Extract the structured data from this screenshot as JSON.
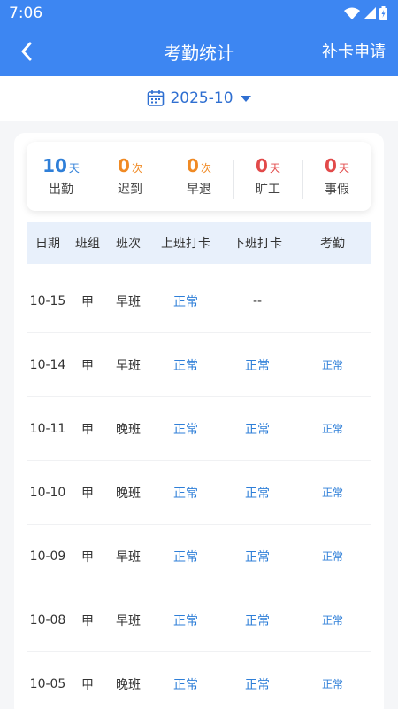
{
  "status_bar": {
    "time": "7:06"
  },
  "nav": {
    "title": "考勤统计",
    "action": "补卡申请"
  },
  "month_selector": {
    "value": "2025-10"
  },
  "colors": {
    "header": "#3d86f2",
    "blue": "#2f7fd8",
    "orange": "#f08a24",
    "red": "#e24a4a"
  },
  "summary": [
    {
      "value": "10",
      "unit": "天",
      "label": "出勤",
      "color": "#2f7fd8"
    },
    {
      "value": "0",
      "unit": "次",
      "label": "迟到",
      "color": "#f08a24"
    },
    {
      "value": "0",
      "unit": "次",
      "label": "早退",
      "color": "#f08a24"
    },
    {
      "value": "0",
      "unit": "天",
      "label": "旷工",
      "color": "#e24a4a"
    },
    {
      "value": "0",
      "unit": "天",
      "label": "事假",
      "color": "#e24a4a"
    }
  ],
  "table": {
    "headers": [
      "日期",
      "班组",
      "班次",
      "上班打卡",
      "下班打卡",
      "考勤"
    ],
    "rows": [
      {
        "date": "10-15",
        "team": "甲",
        "shift": "早班",
        "in": "正常",
        "out": "--",
        "attendance": ""
      },
      {
        "date": "10-14",
        "team": "甲",
        "shift": "早班",
        "in": "正常",
        "out": "正常",
        "attendance": "正常"
      },
      {
        "date": "10-11",
        "team": "甲",
        "shift": "晚班",
        "in": "正常",
        "out": "正常",
        "attendance": "正常"
      },
      {
        "date": "10-10",
        "team": "甲",
        "shift": "晚班",
        "in": "正常",
        "out": "正常",
        "attendance": "正常"
      },
      {
        "date": "10-09",
        "team": "甲",
        "shift": "早班",
        "in": "正常",
        "out": "正常",
        "attendance": "正常"
      },
      {
        "date": "10-08",
        "team": "甲",
        "shift": "早班",
        "in": "正常",
        "out": "正常",
        "attendance": "正常"
      },
      {
        "date": "10-05",
        "team": "甲",
        "shift": "晚班",
        "in": "正常",
        "out": "正常",
        "attendance": "正常"
      }
    ]
  }
}
